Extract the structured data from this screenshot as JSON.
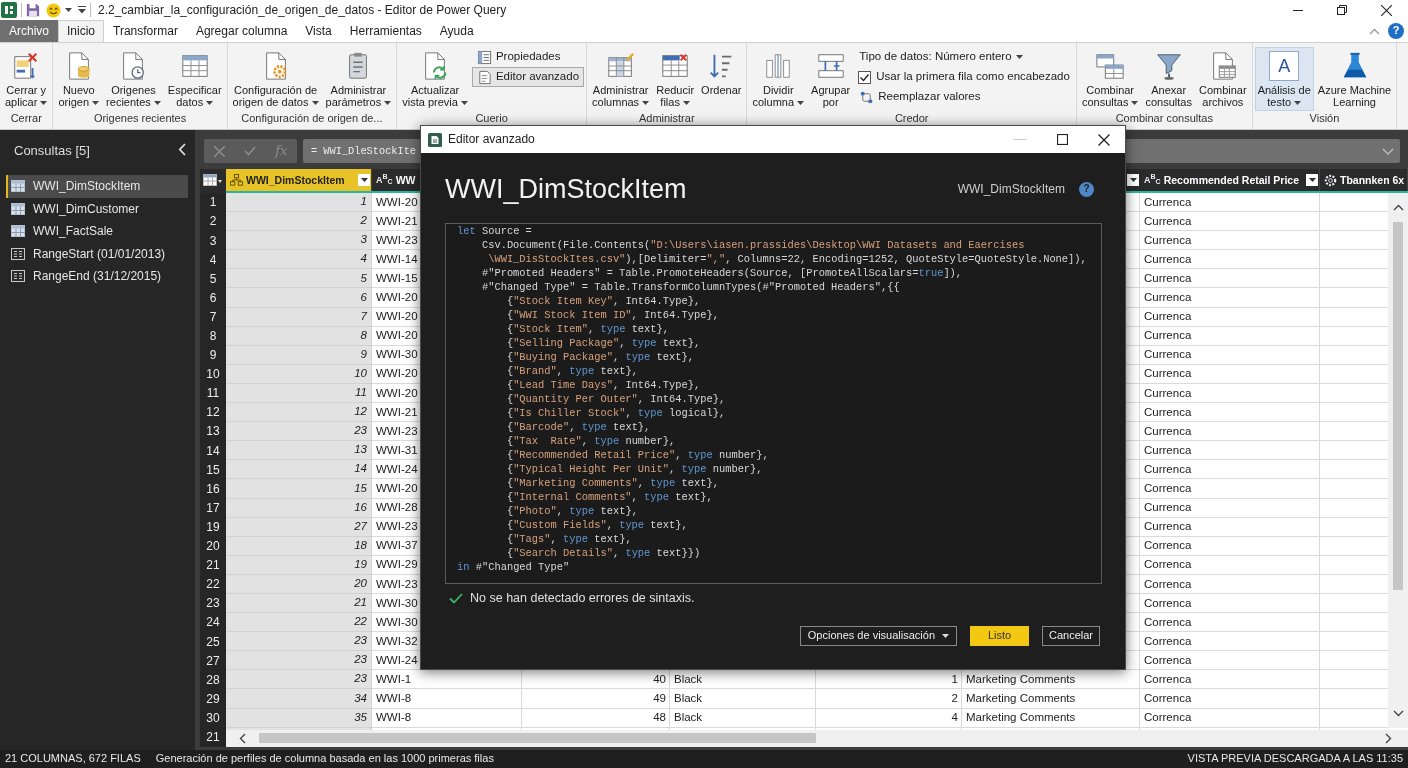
{
  "title_bar": {
    "title": "2.2_cambiar_la_configuración_de_origen_de_datos - Editor de Power Query"
  },
  "ribbon": {
    "tabs": [
      {
        "kind": "file",
        "label": "Archivo",
        "selected": false
      },
      {
        "kind": "tab",
        "label": "Inicio",
        "selected": true
      },
      {
        "kind": "tab",
        "label": "Transformar",
        "selected": false
      },
      {
        "kind": "tab",
        "label": "Agregar columna",
        "selected": false
      },
      {
        "kind": "tab",
        "label": "Vista",
        "selected": false
      },
      {
        "kind": "tab",
        "label": "Herramientas",
        "selected": false
      },
      {
        "kind": "tab",
        "label": "Ayuda",
        "selected": false
      }
    ],
    "help_button": "?",
    "groups": [
      {
        "label": "Cerrar",
        "buttons": [
          {
            "kind": "large",
            "lines": [
              "Cerrar y",
              "aplicar"
            ],
            "dropdown": true,
            "selected": false
          }
        ]
      },
      {
        "label": "Origenes recientes",
        "buttons": [
          {
            "kind": "large",
            "lines": [
              "Nuevo",
              "origen"
            ],
            "dropdown": true,
            "selected": false
          },
          {
            "kind": "large",
            "lines": [
              "Origenes",
              "recientes"
            ],
            "dropdown": true,
            "selected": false
          },
          {
            "kind": "large",
            "lines": [
              "Especificar",
              "datos"
            ],
            "dropdown": true,
            "selected": false
          }
        ]
      },
      {
        "label": "Configuración de origen de...",
        "buttons": [
          {
            "kind": "large",
            "lines": [
              "Configuración de",
              "origen de datos"
            ],
            "dropdown": true,
            "selected": false
          },
          {
            "kind": "large",
            "lines": [
              "Administrar",
              "parámetros"
            ],
            "dropdown": true,
            "selected": false
          }
        ]
      },
      {
        "label": "Cuerio",
        "buttons": [
          {
            "kind": "large",
            "lines": [
              "Actualizar",
              "vista previa"
            ],
            "dropdown": true,
            "selected": false
          },
          {
            "kind": "small",
            "lines": [
              "Propiedades"
            ],
            "dropdown": false,
            "selected": false
          },
          {
            "kind": "small",
            "lines": [
              "Editor avanzado"
            ],
            "dropdown": false,
            "selected": true
          }
        ]
      },
      {
        "label": "Administrar",
        "buttons": [
          {
            "kind": "large",
            "lines": [
              "Administrar",
              "columnas"
            ],
            "dropdown": true,
            "selected": false
          },
          {
            "kind": "large",
            "lines": [
              "Reducir",
              "filas"
            ],
            "dropdown": true,
            "selected": false
          },
          {
            "kind": "large",
            "lines": [
              "Ordenar"
            ],
            "dropdown": false,
            "selected": false
          }
        ]
      },
      {
        "label": "Credor",
        "buttons": [
          {
            "kind": "large",
            "lines": [
              "Dividir",
              "columna"
            ],
            "dropdown": true,
            "selected": false
          },
          {
            "kind": "large",
            "lines": [
              "Agrupar",
              "por"
            ],
            "dropdown": false,
            "selected": false
          },
          {
            "kind": "small",
            "lines": [
              "Tipo de datos: Número entero"
            ],
            "dropdown": true,
            "selected": false
          },
          {
            "kind": "checkbox",
            "lines": [
              "Usar la primera fila como encabezado"
            ],
            "checked": true
          },
          {
            "kind": "small",
            "lines": [
              "Reemplazar valores"
            ],
            "dropdown": false,
            "selected": false
          }
        ]
      },
      {
        "label": "Combinar consultas",
        "buttons": [
          {
            "kind": "large",
            "lines": [
              "Combinar",
              "consultas"
            ],
            "dropdown": true,
            "selected": false
          },
          {
            "kind": "large",
            "lines": [
              "Anexar",
              "consultas"
            ],
            "dropdown": false,
            "selected": false
          },
          {
            "kind": "large",
            "lines": [
              "Combinar",
              "archivos"
            ],
            "dropdown": false,
            "selected": false
          }
        ]
      },
      {
        "label": "Visión",
        "buttons": [
          {
            "kind": "large",
            "glyph": "A",
            "lines": [
              "Análisis de",
              "testo"
            ],
            "dropdown": true,
            "selected": true
          },
          {
            "kind": "large",
            "lines": [
              "Azure Machine",
              "Learning"
            ],
            "dropdown": false,
            "selected": false
          }
        ]
      }
    ]
  },
  "queries": {
    "title": "Consultas [5]",
    "items": [
      {
        "kind": "table",
        "label": "WWI_DimStockItem",
        "selected": true
      },
      {
        "kind": "table",
        "label": "WWI_DimCustomer",
        "selected": false
      },
      {
        "kind": "table",
        "label": "WWI_FactSale",
        "selected": false
      },
      {
        "kind": "parameter",
        "label": "RangeStart (01/01/2013)",
        "selected": false
      },
      {
        "kind": "parameter",
        "label": "RangeEnd (31/12/2015)",
        "selected": false
      }
    ]
  },
  "formula_bar": {
    "buttons": [
      {
        "kind": "cancel",
        "disabled": true
      },
      {
        "kind": "commit",
        "disabled": true
      },
      {
        "kind": "function",
        "label": "fx",
        "disabled": true
      }
    ],
    "value": "= WWI_DleStockIte"
  },
  "table": {
    "columns": [
      {
        "kind": "key",
        "label": "WWI_DimStockItem",
        "selected": true,
        "filter_button": true
      },
      {
        "kind": "text",
        "type_label": "A$^{B}$$_{C}$",
        "label": "WW",
        "selected": false
      },
      {
        "kind": "number",
        "selected": false
      },
      {
        "kind": "text",
        "selected": false
      },
      {
        "kind": "number",
        "selected": false
      },
      {
        "kind": "text",
        "selected": false,
        "filter_button": true
      },
      {
        "kind": "text",
        "type_label": "A$^{B}$$_{C}$",
        "label": "Recommended Retail Price",
        "selected": false,
        "filter_button": true
      },
      {
        "kind": "custom",
        "label": "Tbannken 6x",
        "selected": false,
        "filter_button": false
      }
    ],
    "rows": [
      {
        "row_number": "1",
        "column_1": "1",
        "column_2": "WWI-20",
        "column_7": "Currenca"
      },
      {
        "row_number": "2",
        "column_1": "2",
        "column_2": "WWI-21",
        "column_7": "Currenca"
      },
      {
        "row_number": "3",
        "column_1": "3",
        "column_2": "WWI-23",
        "column_7": "Currenca"
      },
      {
        "row_number": "4",
        "column_1": "4",
        "column_2": "WWI-14",
        "column_7": "Currenca"
      },
      {
        "row_number": "5",
        "column_1": "5",
        "column_2": "WWI-15",
        "column_7": "Currenca"
      },
      {
        "row_number": "6",
        "column_1": "6",
        "column_2": "WWI-20",
        "column_7": "Currenca"
      },
      {
        "row_number": "7",
        "column_1": "7",
        "column_2": "WWI-20",
        "column_7": "Currenca"
      },
      {
        "row_number": "8",
        "column_1": "8",
        "column_2": "WWI-20",
        "column_7": "Currenca"
      },
      {
        "row_number": "9",
        "column_1": "9",
        "column_2": "WWI-30",
        "column_7": "Currenca"
      },
      {
        "row_number": "10",
        "column_1": "10",
        "column_2": "WWI-20",
        "column_7": "Currenca"
      },
      {
        "row_number": "11",
        "column_1": "11",
        "column_2": "WWI-20",
        "column_7": "Currenca"
      },
      {
        "row_number": "12",
        "column_1": "12",
        "column_2": "WWI-21",
        "column_7": "Currenca"
      },
      {
        "row_number": "13",
        "column_1": "23",
        "column_2": "WWI-23",
        "column_7": "Currenca"
      },
      {
        "row_number": "14",
        "column_1": "13",
        "column_2": "WWI-31",
        "column_7": "Currenca"
      },
      {
        "row_number": "15",
        "column_1": "14",
        "column_2": "WWI-24",
        "column_7": "Currenca"
      },
      {
        "row_number": "16",
        "column_1": "15",
        "column_2": "WWI-20",
        "column_7": "Correnca"
      },
      {
        "row_number": "17",
        "column_1": "16",
        "column_2": "WWI-28",
        "column_7": "Currenca"
      },
      {
        "row_number": "19",
        "column_1": "27",
        "column_2": "WWI-23",
        "column_7": "Currenca"
      },
      {
        "row_number": "20",
        "column_1": "18",
        "column_2": "WWI-37",
        "column_7": "Correnca"
      },
      {
        "row_number": "21",
        "column_1": "19",
        "column_2": "WWI-29",
        "column_7": "Correnca"
      },
      {
        "row_number": "22",
        "column_1": "20",
        "column_2": "WWI-23",
        "column_7": "Correnca"
      },
      {
        "row_number": "23",
        "column_1": "21",
        "column_2": "WWI-30",
        "column_7": "Correnca"
      },
      {
        "row_number": "24",
        "column_1": "22",
        "column_2": "WWI-30",
        "column_7": "Correnca"
      },
      {
        "row_number": "25",
        "column_1": "23",
        "column_2": "WWI-32",
        "column_7": "Correnca"
      },
      {
        "row_number": "27",
        "column_1": "23",
        "column_2": "WWI-24",
        "column_7": "Correnca"
      },
      {
        "row_number": "28",
        "column_1": "23",
        "column_2": "WWI-1",
        "column_3": "40",
        "column_4": "Black",
        "column_5": "1",
        "column_6": "Marketing Comments",
        "column_7": "Correnca"
      },
      {
        "row_number": "29",
        "column_1": "34",
        "column_2": "WWI-8",
        "column_3": "49",
        "column_4": "Black",
        "column_5": "2",
        "column_6": "Marketing Comments",
        "column_7": "Correnca"
      },
      {
        "row_number": "30",
        "column_1": "35",
        "column_2": "WWI-8",
        "column_3": "48",
        "column_4": "Black",
        "column_5": "4",
        "column_6": "Marketing Comments",
        "column_7": "Correnca"
      },
      {
        "row_number": "21"
      }
    ]
  },
  "status_bar": {
    "left": [
      "21 COLUMNAS, 672 FILAS",
      "Generación de perfiles de columna basada en las 1000 primeras filas"
    ],
    "right": "VISTA PREVIA DESCARGADA A LAS 11:35"
  },
  "dialog": {
    "title": "Editor avanzado",
    "controls": [
      {
        "kind": "minimize",
        "disabled": true
      },
      {
        "kind": "maximize",
        "disabled": false
      },
      {
        "kind": "close",
        "disabled": false
      }
    ],
    "heading": "WWI_DimStockItem",
    "query_name": "WWI_DimStockItem",
    "help_button": "?",
    "code": [
      {
        "tokens": [
          {
            "kind": "keyword",
            "text": "let"
          },
          {
            "kind": "plain",
            "text": " Source ="
          }
        ]
      },
      {
        "tokens": [
          {
            "kind": "plain",
            "text": "    Csv.Document(File.Contents("
          },
          {
            "kind": "string",
            "text": "\"D:\\Users\\iasen.prassides\\Desktop\\WWI Datasets and Eaercises"
          }
        ]
      },
      {
        "tokens": [
          {
            "kind": "string",
            "text": "     \\WWI_DisStockItes.csv\""
          },
          {
            "kind": "plain",
            "text": "),[Delimiter="
          },
          {
            "kind": "string",
            "text": "\",\""
          },
          {
            "kind": "plain",
            "text": ", Columns=22, Encoding=1252, QuoteStyle=QuoteStyle.None]),"
          }
        ]
      },
      {
        "tokens": [
          {
            "kind": "plain",
            "text": "    #\"Promoted Headers\" = Table.PromoteHeaders(Source, [PromoteAllScalars="
          },
          {
            "kind": "keyword",
            "text": "true"
          },
          {
            "kind": "plain",
            "text": "]),"
          }
        ]
      },
      {
        "tokens": [
          {
            "kind": "plain",
            "text": "    #\"Changed Type\" = Table.TransformColumnTypes(#\"Promoted Headers\",{{"
          }
        ]
      },
      {
        "tokens": [
          {
            "kind": "plain",
            "text": "        {"
          },
          {
            "kind": "string",
            "text": "\"Stock Item Key\""
          },
          {
            "kind": "plain",
            "text": ", Int64.Type},"
          }
        ]
      },
      {
        "tokens": [
          {
            "kind": "plain",
            "text": "        {"
          },
          {
            "kind": "string",
            "text": "\"WWI Stock Item ID\""
          },
          {
            "kind": "plain",
            "text": ", Int64.Type},"
          }
        ]
      },
      {
        "tokens": [
          {
            "kind": "plain",
            "text": "        {"
          },
          {
            "kind": "string",
            "text": "\"Stock Item\""
          },
          {
            "kind": "plain",
            "text": ", "
          },
          {
            "kind": "keyword",
            "text": "type"
          },
          {
            "kind": "plain",
            "text": " text},"
          }
        ]
      },
      {
        "tokens": [
          {
            "kind": "plain",
            "text": "        {"
          },
          {
            "kind": "string",
            "text": "\"Selling Package\""
          },
          {
            "kind": "plain",
            "text": ", "
          },
          {
            "kind": "keyword",
            "text": "type"
          },
          {
            "kind": "plain",
            "text": " text},"
          }
        ]
      },
      {
        "tokens": [
          {
            "kind": "plain",
            "text": "        {"
          },
          {
            "kind": "string",
            "text": "\"Buying Package\""
          },
          {
            "kind": "plain",
            "text": ", "
          },
          {
            "kind": "keyword",
            "text": "type"
          },
          {
            "kind": "plain",
            "text": " text},"
          }
        ]
      },
      {
        "tokens": [
          {
            "kind": "plain",
            "text": "        {"
          },
          {
            "kind": "string",
            "text": "\"Brand\""
          },
          {
            "kind": "plain",
            "text": ", "
          },
          {
            "kind": "keyword",
            "text": "type"
          },
          {
            "kind": "plain",
            "text": " text},"
          }
        ]
      },
      {
        "tokens": [
          {
            "kind": "plain",
            "text": "        {"
          },
          {
            "kind": "string",
            "text": "\"Lead Time Days\""
          },
          {
            "kind": "plain",
            "text": ", Int64.Type},"
          }
        ]
      },
      {
        "tokens": [
          {
            "kind": "plain",
            "text": "        {"
          },
          {
            "kind": "string",
            "text": "\"Quantity Per Outer\""
          },
          {
            "kind": "plain",
            "text": ", Int64.Type},"
          }
        ]
      },
      {
        "tokens": [
          {
            "kind": "plain",
            "text": "        {"
          },
          {
            "kind": "string",
            "text": "\"Is Chiller Stock\""
          },
          {
            "kind": "plain",
            "text": ", "
          },
          {
            "kind": "keyword",
            "text": "type"
          },
          {
            "kind": "plain",
            "text": " logical},"
          }
        ]
      },
      {
        "tokens": [
          {
            "kind": "plain",
            "text": "        {"
          },
          {
            "kind": "string",
            "text": "\"Barcode\""
          },
          {
            "kind": "plain",
            "text": ", "
          },
          {
            "kind": "keyword",
            "text": "type"
          },
          {
            "kind": "plain",
            "text": " text},"
          }
        ]
      },
      {
        "tokens": [
          {
            "kind": "plain",
            "text": "        {"
          },
          {
            "kind": "string",
            "text": "\"Tax  Rate\""
          },
          {
            "kind": "plain",
            "text": ", "
          },
          {
            "kind": "keyword",
            "text": "type"
          },
          {
            "kind": "plain",
            "text": " number},"
          }
        ]
      },
      {
        "tokens": [
          {
            "kind": "plain",
            "text": "        {"
          },
          {
            "kind": "string",
            "text": "\"Recommended Retail Price\""
          },
          {
            "kind": "plain",
            "text": ", "
          },
          {
            "kind": "keyword",
            "text": "type"
          },
          {
            "kind": "plain",
            "text": " number},"
          }
        ]
      },
      {
        "tokens": [
          {
            "kind": "plain",
            "text": "        {"
          },
          {
            "kind": "string",
            "text": "\"Typical Height Per Unit\""
          },
          {
            "kind": "plain",
            "text": ", "
          },
          {
            "kind": "keyword",
            "text": "type"
          },
          {
            "kind": "plain",
            "text": " number},"
          }
        ]
      },
      {
        "tokens": [
          {
            "kind": "plain",
            "text": "        {"
          },
          {
            "kind": "string",
            "text": "\"Marketing Comments\""
          },
          {
            "kind": "plain",
            "text": ", "
          },
          {
            "kind": "keyword",
            "text": "type"
          },
          {
            "kind": "plain",
            "text": " text},"
          }
        ]
      },
      {
        "tokens": [
          {
            "kind": "plain",
            "text": "        {"
          },
          {
            "kind": "string",
            "text": "\"Internal Comments\""
          },
          {
            "kind": "plain",
            "text": ", "
          },
          {
            "kind": "keyword",
            "text": "type"
          },
          {
            "kind": "plain",
            "text": " text},"
          }
        ]
      },
      {
        "tokens": [
          {
            "kind": "plain",
            "text": "        {"
          },
          {
            "kind": "string",
            "text": "\"Photo\""
          },
          {
            "kind": "plain",
            "text": ", "
          },
          {
            "kind": "keyword",
            "text": "type"
          },
          {
            "kind": "plain",
            "text": " text},"
          }
        ]
      },
      {
        "tokens": [
          {
            "kind": "plain",
            "text": "        {"
          },
          {
            "kind": "string",
            "text": "\"Custom Fields\""
          },
          {
            "kind": "plain",
            "text": ", "
          },
          {
            "kind": "keyword",
            "text": "type"
          },
          {
            "kind": "plain",
            "text": " text},"
          }
        ]
      },
      {
        "tokens": [
          {
            "kind": "plain",
            "text": "        {"
          },
          {
            "kind": "string",
            "text": "\"Tags\""
          },
          {
            "kind": "plain",
            "text": ", "
          },
          {
            "kind": "keyword",
            "text": "type"
          },
          {
            "kind": "plain",
            "text": " text},"
          }
        ]
      },
      {
        "tokens": [
          {
            "kind": "plain",
            "text": "        {"
          },
          {
            "kind": "string",
            "text": "\"Search Details\""
          },
          {
            "kind": "plain",
            "text": ", "
          },
          {
            "kind": "keyword",
            "text": "type"
          },
          {
            "kind": "plain",
            "text": " text}})"
          }
        ]
      },
      {
        "tokens": [
          {
            "kind": "keyword",
            "text": "in"
          },
          {
            "kind": "plain",
            "text": " #\"Changed Type\""
          }
        ]
      }
    ],
    "syntax_status": {
      "ok": true,
      "text": "No se han detectado errores de sintaxis."
    },
    "buttons": [
      {
        "kind": "dropdown",
        "label": "Opciones de visualisación"
      },
      {
        "kind": "primary",
        "label": "Listo"
      },
      {
        "kind": "secondary",
        "label": "Cancelar"
      }
    ]
  }
}
